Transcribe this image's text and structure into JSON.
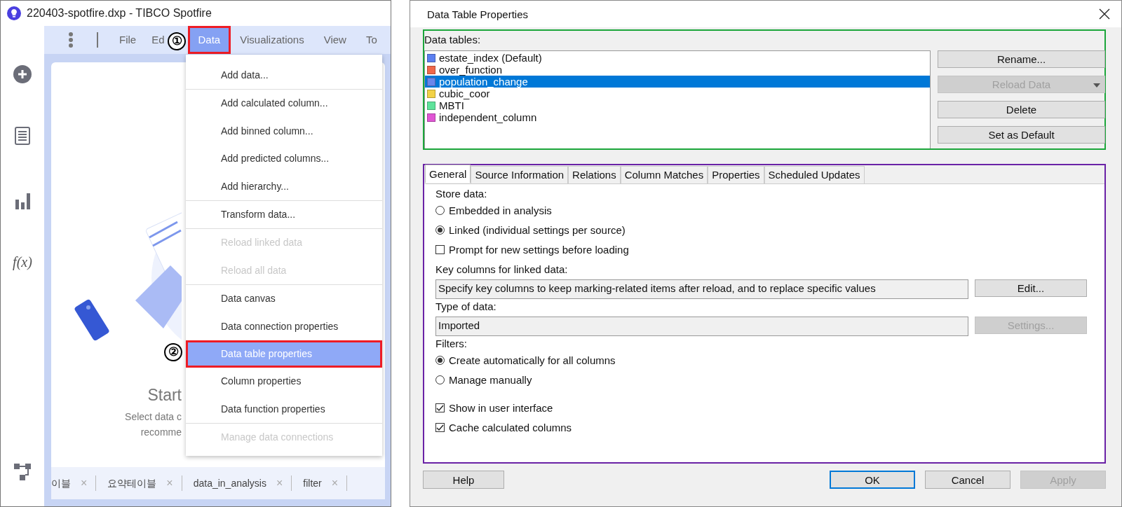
{
  "app_window": {
    "title": "220403-spotfire.dxp - TIBCO Spotfire",
    "sidebar": {
      "formula_label": "f(x)"
    },
    "menu_bar": [
      {
        "label": "File",
        "selected": false,
        "highlighted": false
      },
      {
        "label": "Ed",
        "selected": false,
        "highlighted": false
      },
      {
        "label": "Data",
        "selected": true,
        "highlighted": true
      },
      {
        "label": "Visualizations",
        "selected": false,
        "highlighted": false
      },
      {
        "label": "View",
        "selected": false,
        "highlighted": false
      },
      {
        "label": "To",
        "selected": false,
        "highlighted": false
      }
    ],
    "canvas": {
      "heading": "Start",
      "lines": [
        "Select data c",
        "recomme"
      ]
    },
    "data_menu": {
      "groups": [
        {
          "items": [
            {
              "label": "Add data...",
              "disabled": false,
              "selected": false,
              "highlighted": false
            }
          ]
        },
        {
          "items": [
            {
              "label": "Add calculated column...",
              "disabled": false,
              "selected": false,
              "highlighted": false
            },
            {
              "label": "Add binned column...",
              "disabled": false,
              "selected": false,
              "highlighted": false
            },
            {
              "label": "Add predicted columns...",
              "disabled": false,
              "selected": false,
              "highlighted": false
            },
            {
              "label": "Add hierarchy...",
              "disabled": false,
              "selected": false,
              "highlighted": false
            }
          ]
        },
        {
          "items": [
            {
              "label": "Transform data...",
              "disabled": false,
              "selected": false,
              "highlighted": false
            }
          ]
        },
        {
          "items": [
            {
              "label": "Reload linked data",
              "disabled": true,
              "selected": false,
              "highlighted": false
            },
            {
              "label": "Reload all data",
              "disabled": true,
              "selected": false,
              "highlighted": false
            }
          ]
        },
        {
          "items": [
            {
              "label": "Data canvas",
              "disabled": false,
              "selected": false,
              "highlighted": false
            },
            {
              "label": "Data connection properties",
              "disabled": false,
              "selected": false,
              "highlighted": false
            },
            {
              "label": "Data table properties",
              "disabled": false,
              "selected": true,
              "highlighted": true
            },
            {
              "label": "Column properties",
              "disabled": false,
              "selected": false,
              "highlighted": false
            },
            {
              "label": "Data function properties",
              "disabled": false,
              "selected": false,
              "highlighted": false
            }
          ]
        },
        {
          "items": [
            {
              "label": "Manage data connections",
              "disabled": true,
              "selected": false,
              "highlighted": false
            }
          ]
        }
      ]
    },
    "page_tabs": [
      {
        "label": "이블",
        "close": "×"
      },
      {
        "label": "요약테이블",
        "close": "×"
      },
      {
        "label": "data_in_analysis",
        "close": "×"
      },
      {
        "label": "filter",
        "close": "×"
      }
    ]
  },
  "annotations": [
    {
      "text": "①"
    },
    {
      "text": "②"
    }
  ],
  "dialog": {
    "title": "Data Table Properties",
    "data_tables": {
      "label": "Data tables:",
      "items": [
        {
          "name": "estate_index (Default)",
          "color": "#5b7ff0",
          "selected": false
        },
        {
          "name": "over_function",
          "color": "#f0684a",
          "selected": false
        },
        {
          "name": "population_change",
          "color": "#6a86ea",
          "selected": true
        },
        {
          "name": "cubic_coor",
          "color": "#f2d246",
          "selected": false
        },
        {
          "name": "MBTI",
          "color": "#5ee39b",
          "selected": false
        },
        {
          "name": "independent_column",
          "color": "#e055d4",
          "selected": false
        }
      ]
    },
    "table_buttons": [
      {
        "label": "Rename...",
        "disabled": false,
        "kind": "plain"
      },
      {
        "label": "Reload Data",
        "disabled": true,
        "kind": "split"
      },
      {
        "label": "Delete",
        "disabled": false,
        "kind": "plain"
      },
      {
        "label": "Set as Default",
        "disabled": false,
        "kind": "plain"
      }
    ],
    "tabs": [
      {
        "label": "General",
        "selected": true
      },
      {
        "label": "Source Information",
        "selected": false
      },
      {
        "label": "Relations",
        "selected": false
      },
      {
        "label": "Column Matches",
        "selected": false
      },
      {
        "label": "Properties",
        "selected": false
      },
      {
        "label": "Scheduled Updates",
        "selected": false
      }
    ],
    "general": {
      "store_label": "Store data:",
      "store_options": [
        {
          "label": "Embedded in analysis",
          "kind": "radio",
          "checked": false
        },
        {
          "label": "Linked (individual settings per source)",
          "kind": "radio",
          "checked": true
        },
        {
          "label": "Prompt for new settings before loading",
          "kind": "checkbox",
          "checked": false
        }
      ],
      "key_label": "Key columns for linked data:",
      "key_field": {
        "value": "Specify key columns to keep marking-related items after reload, and to replace specific values",
        "button": "Edit...",
        "button_disabled": false
      },
      "type_label": "Type of data:",
      "type_field": {
        "value": "Imported",
        "button": "Settings...",
        "button_disabled": true
      },
      "filters_label": "Filters:",
      "filter_options": [
        {
          "label": "Create automatically for all columns",
          "kind": "radio",
          "checked": true
        },
        {
          "label": "Manage manually",
          "kind": "radio",
          "checked": false
        }
      ],
      "options": [
        {
          "label": "Show in user interface",
          "kind": "checkbox",
          "checked": true
        },
        {
          "label": "Cache calculated columns",
          "kind": "checkbox",
          "checked": true
        }
      ]
    },
    "footer_buttons": [
      {
        "label": "Help",
        "disabled": false,
        "default": false
      },
      {
        "label": "OK",
        "disabled": false,
        "default": true
      },
      {
        "label": "Cancel",
        "disabled": false,
        "default": false
      },
      {
        "label": "Apply",
        "disabled": true,
        "default": false
      }
    ]
  }
}
